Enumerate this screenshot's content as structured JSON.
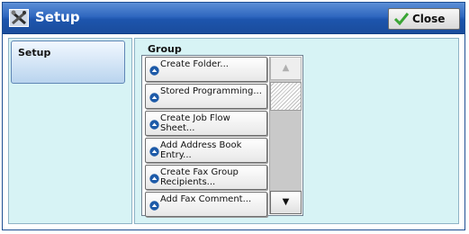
{
  "window": {
    "title": "Setup",
    "close_label": "Close"
  },
  "tabs": [
    {
      "label": "Setup",
      "selected": true
    }
  ],
  "group": {
    "heading": "Group",
    "items": [
      {
        "label": "Create Folder..."
      },
      {
        "label": "Stored Programming..."
      },
      {
        "label": "Create Job Flow\nSheet..."
      },
      {
        "label": "Add Address Book\nEntry..."
      },
      {
        "label": "Create Fax Group\nRecipients..."
      },
      {
        "label": "Add Fax Comment..."
      }
    ],
    "scroll": {
      "up_glyph": "▲",
      "down_glyph": "▼",
      "up_enabled": false,
      "down_enabled": true
    }
  },
  "colors": {
    "titlebar": "#2f67bf",
    "panel_bg": "#d7f3f5",
    "item_icon": "#1d5aa8",
    "check": "#3aa535"
  },
  "icons": {
    "title": "setup-tools-icon",
    "close": "checkmark-icon",
    "item": "blue-circle-arrow-icon"
  }
}
